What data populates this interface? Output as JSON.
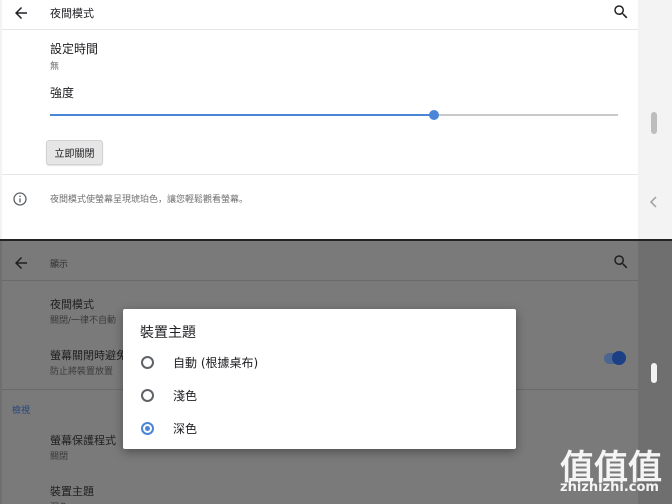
{
  "top": {
    "title": "夜間模式",
    "schedule": {
      "label": "設定時間",
      "value": "無"
    },
    "intensity": {
      "label": "強度",
      "level_percent": 68
    },
    "turn_off_button": "立即關閉",
    "info_text": "夜間模式使螢幕呈現琥珀色，讓您輕鬆觀看螢幕。"
  },
  "bottom": {
    "title": "顯示",
    "items": [
      {
        "label": "夜間模式",
        "sub": "關閉/一律不自動"
      },
      {
        "label": "螢幕關閉時避免",
        "sub": "防止將裝置放置"
      },
      {
        "label": "螢幕保護程式",
        "sub": "關閉"
      },
      {
        "label": "裝置主題",
        "sub": "深色"
      }
    ],
    "section_header": "檢視",
    "toggle_on": true
  },
  "dialog": {
    "title": "裝置主題",
    "options": [
      {
        "label": "自動 (根據桌布)",
        "selected": false
      },
      {
        "label": "淺色",
        "selected": false
      },
      {
        "label": "深色",
        "selected": true
      }
    ]
  },
  "watermark": {
    "glyphs": "值值值",
    "url": "zhizhizhi.com"
  },
  "colors": {
    "accent": "#4a86d6",
    "dimmed_background": "#7a7a7a"
  }
}
